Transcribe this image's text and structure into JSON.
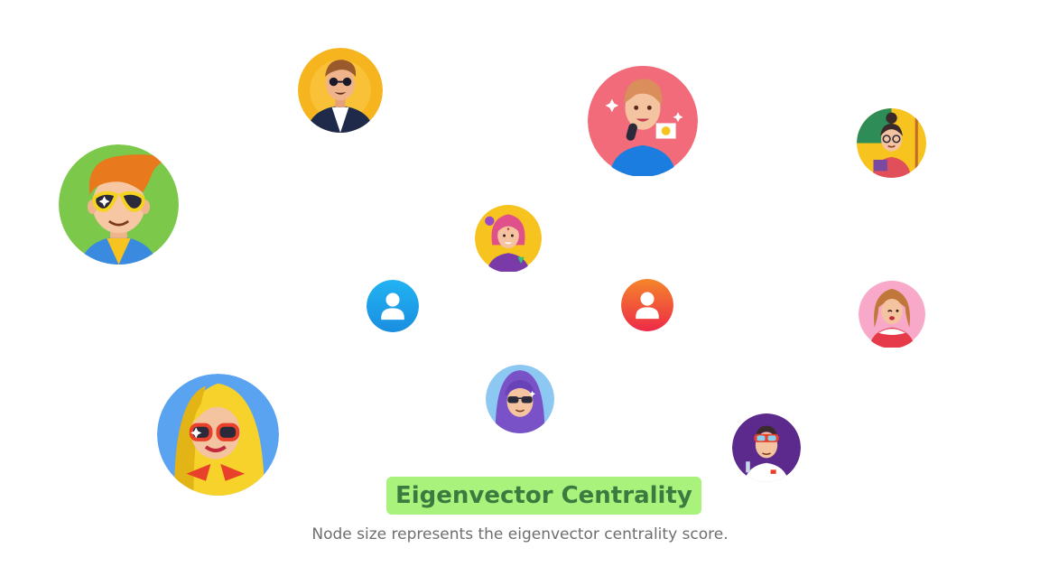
{
  "caption": {
    "title": "Eigenvector Centrality",
    "subtitle": "Node size represents the eigenvector centrality score."
  },
  "nodes": [
    {
      "name": "avatar-man-suit-sunglasses-icon",
      "bg": "#f6b51e"
    },
    {
      "name": "avatar-woman-microphone-icon",
      "bg": "#f26b7a"
    },
    {
      "name": "avatar-teacher-woman-icon",
      "bg": "#2e8c57"
    },
    {
      "name": "avatar-boy-yellow-sunglasses-icon",
      "bg": "#7cc84a"
    },
    {
      "name": "avatar-girl-pink-hair-icon",
      "bg": "#f6c31f"
    },
    {
      "name": "generic-user-blue-icon",
      "bg": "#1ea6f0"
    },
    {
      "name": "generic-user-red-icon",
      "bg": "#f2403f"
    },
    {
      "name": "avatar-woman-pink-background-icon",
      "bg": "#f8a8c8"
    },
    {
      "name": "avatar-blonde-woman-red-glasses-icon",
      "bg": "#5aa3f0"
    },
    {
      "name": "avatar-hooded-person-sunglasses-icon",
      "bg": "#8cc8f2"
    },
    {
      "name": "avatar-scientist-goggles-icon",
      "bg": "#5b2a8c"
    }
  ]
}
